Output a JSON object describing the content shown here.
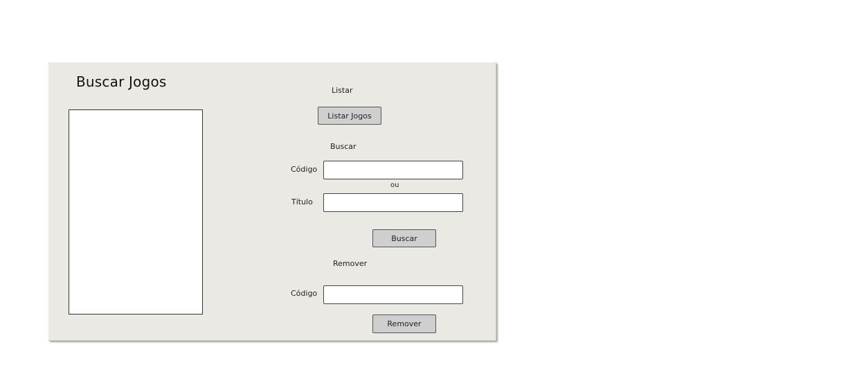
{
  "screen": {
    "title": "Buscar Jogos"
  },
  "listar": {
    "section_label": "Listar",
    "button_label": "Listar Jogos"
  },
  "buscar": {
    "section_label": "Buscar",
    "codigo_label": "Código",
    "codigo_value": "",
    "separator": "ou",
    "titulo_label": "Título",
    "titulo_value": "",
    "button_label": "Buscar"
  },
  "remover": {
    "section_label": "Remover",
    "codigo_label": "Código",
    "codigo_value": "",
    "button_label": "Remover"
  },
  "results_list": {
    "items": []
  }
}
